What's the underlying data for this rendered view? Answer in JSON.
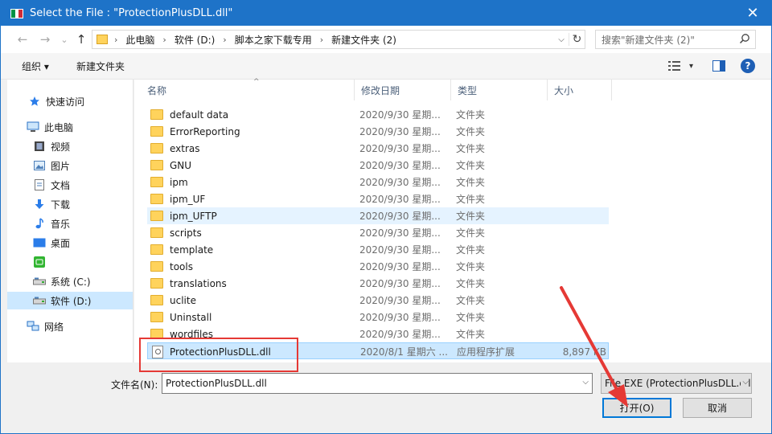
{
  "window": {
    "title": "Select the File : \"ProtectionPlusDLL.dll\"",
    "close_glyph": "✕"
  },
  "nav": {
    "back_glyph": "←",
    "forward_glyph": "→",
    "recent_glyph": "⌄",
    "up_glyph": "↑"
  },
  "address": {
    "crumbs": [
      "此电脑",
      "软件 (D:)",
      "脚本之家下载专用",
      "新建文件夹 (2)"
    ],
    "separator": "›",
    "dropdown_glyph": "⌵",
    "refresh_glyph": "↻"
  },
  "search": {
    "placeholder": "搜索\"新建文件夹 (2)\""
  },
  "toolbar": {
    "organize_label": "组织 ▾",
    "new_folder_label": "新建文件夹",
    "view_dd_glyph": "▾",
    "help_glyph": "?"
  },
  "sidebar": {
    "items": [
      {
        "label": "快速访问",
        "icon": "star-icon"
      },
      {
        "label": "此电脑",
        "icon": "computer-icon"
      },
      {
        "label": "视频",
        "icon": "video-icon"
      },
      {
        "label": "图片",
        "icon": "pictures-icon"
      },
      {
        "label": "文档",
        "icon": "documents-icon"
      },
      {
        "label": "下载",
        "icon": "downloads-icon"
      },
      {
        "label": "音乐",
        "icon": "music-icon"
      },
      {
        "label": "桌面",
        "icon": "desktop-icon"
      },
      {
        "label": "",
        "icon": "app-tile-icon"
      },
      {
        "label": "系统 (C:)",
        "icon": "drive-icon"
      },
      {
        "label": "软件 (D:)",
        "icon": "drive-icon",
        "selected": true
      },
      {
        "label": "网络",
        "icon": "network-icon"
      }
    ]
  },
  "columns": {
    "name": "名称",
    "date": "修改日期",
    "type": "类型",
    "size": "大小"
  },
  "files": [
    {
      "name": "default data",
      "date": "2020/9/30 星期...",
      "type": "文件夹",
      "size": "",
      "kind": "folder"
    },
    {
      "name": "ErrorReporting",
      "date": "2020/9/30 星期...",
      "type": "文件夹",
      "size": "",
      "kind": "folder"
    },
    {
      "name": "extras",
      "date": "2020/9/30 星期...",
      "type": "文件夹",
      "size": "",
      "kind": "folder"
    },
    {
      "name": "GNU",
      "date": "2020/9/30 星期...",
      "type": "文件夹",
      "size": "",
      "kind": "folder"
    },
    {
      "name": "ipm",
      "date": "2020/9/30 星期...",
      "type": "文件夹",
      "size": "",
      "kind": "folder"
    },
    {
      "name": "ipm_UF",
      "date": "2020/9/30 星期...",
      "type": "文件夹",
      "size": "",
      "kind": "folder"
    },
    {
      "name": "ipm_UFTP",
      "date": "2020/9/30 星期...",
      "type": "文件夹",
      "size": "",
      "kind": "folder",
      "hover": true
    },
    {
      "name": "scripts",
      "date": "2020/9/30 星期...",
      "type": "文件夹",
      "size": "",
      "kind": "folder"
    },
    {
      "name": "template",
      "date": "2020/9/30 星期...",
      "type": "文件夹",
      "size": "",
      "kind": "folder"
    },
    {
      "name": "tools",
      "date": "2020/9/30 星期...",
      "type": "文件夹",
      "size": "",
      "kind": "folder"
    },
    {
      "name": "translations",
      "date": "2020/9/30 星期...",
      "type": "文件夹",
      "size": "",
      "kind": "folder"
    },
    {
      "name": "uclite",
      "date": "2020/9/30 星期...",
      "type": "文件夹",
      "size": "",
      "kind": "folder"
    },
    {
      "name": "Uninstall",
      "date": "2020/9/30 星期...",
      "type": "文件夹",
      "size": "",
      "kind": "folder"
    },
    {
      "name": "wordfiles",
      "date": "2020/9/30 星期...",
      "type": "文件夹",
      "size": "",
      "kind": "folder"
    },
    {
      "name": "ProtectionPlusDLL.dll",
      "date": "2020/8/1 星期六 ...",
      "type": "应用程序扩展",
      "size": "8,897 KB",
      "kind": "dll",
      "selected": true
    }
  ],
  "bottom": {
    "filename_label": "文件名(N):",
    "filename_value": "ProtectionPlusDLL.dll",
    "filter_value": "File EXE (ProtectionPlusDLL.dll)",
    "open_label": "打开(O)",
    "cancel_label": "取消",
    "dropdown_glyph": "⌵"
  },
  "colors": {
    "accent": "#1e73c8",
    "selection": "#cce8ff",
    "annotation": "#e53935"
  }
}
